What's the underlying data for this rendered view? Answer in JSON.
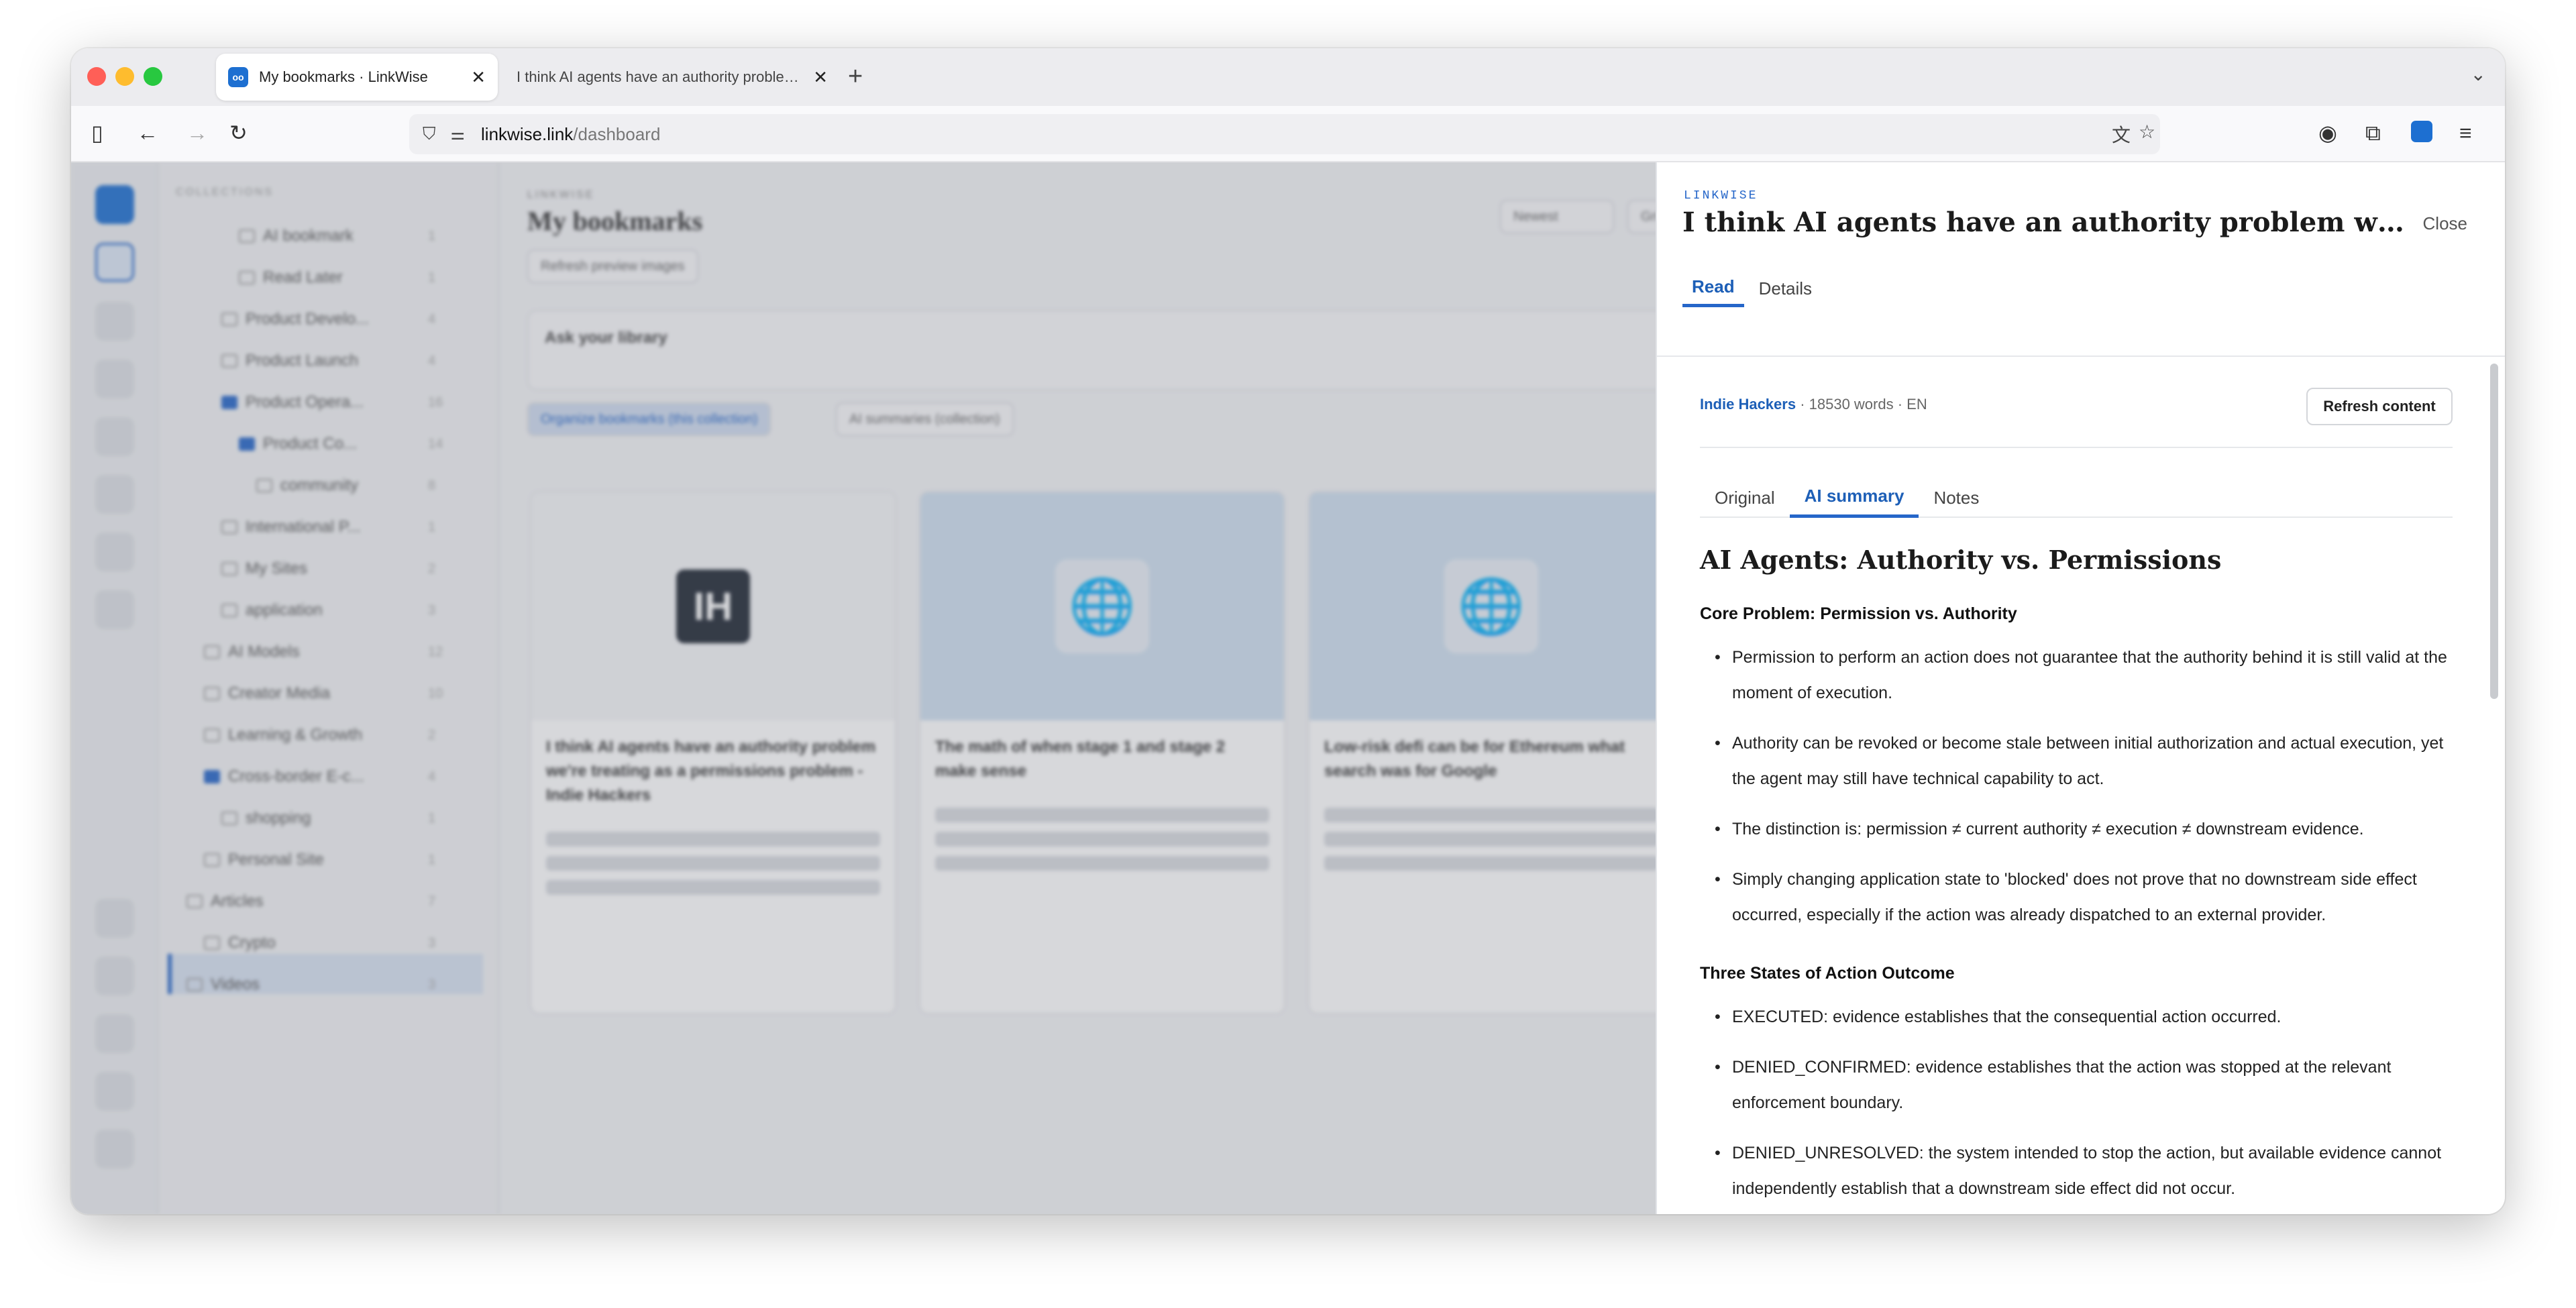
{
  "browser": {
    "tabs": [
      {
        "title": "My bookmarks · LinkWise",
        "close": "✕",
        "active": true
      },
      {
        "title": "I think AI agents have an authority problem we're treating as a permissions problem",
        "close": "✕",
        "active": false
      }
    ],
    "new_tab": "+",
    "tabs_menu": "⌄",
    "url_host": "linkwise.link",
    "url_path": "/dashboard",
    "favicon_text": "oo"
  },
  "app": {
    "sidebar_header": "COLLECTIONS",
    "tree": [
      {
        "label": "AI bookmark",
        "count": "1",
        "indent": 3
      },
      {
        "label": "Read Later",
        "count": "1",
        "indent": 3
      },
      {
        "label": "Product Develo...",
        "count": "4",
        "indent": 2
      },
      {
        "label": "Product Launch",
        "count": "4",
        "indent": 2
      },
      {
        "label": "Product Opera...",
        "count": "16",
        "indent": 2,
        "blue": true
      },
      {
        "label": "Product Co...",
        "count": "14",
        "indent": 3,
        "blue": true
      },
      {
        "label": "community",
        "count": "8",
        "indent": 4
      },
      {
        "label": "International P...",
        "count": "1",
        "indent": 2
      },
      {
        "label": "My Sites",
        "count": "2",
        "indent": 2
      },
      {
        "label": "application",
        "count": "3",
        "indent": 2
      },
      {
        "label": "AI Models",
        "count": "12",
        "indent": 1
      },
      {
        "label": "Creator Media",
        "count": "10",
        "indent": 1
      },
      {
        "label": "Learning & Growth",
        "count": "2",
        "indent": 1
      },
      {
        "label": "Cross-border E-c...",
        "count": "4",
        "indent": 1,
        "blue": true
      },
      {
        "label": "shopping",
        "count": "1",
        "indent": 2
      },
      {
        "label": "Personal Site",
        "count": "1",
        "indent": 1
      },
      {
        "label": "Articles",
        "count": "7",
        "indent": 0
      },
      {
        "label": "Crypto",
        "count": "3",
        "indent": 1
      },
      {
        "label": "Videos",
        "count": "3",
        "indent": 0
      }
    ],
    "brand": "LINKWISE",
    "title": "My bookmarks",
    "sort": "Newest",
    "view": "Grid",
    "refresh_previews": "Refresh preview images",
    "ask_title": "Ask your library",
    "organize": "Organize bookmarks (this collection)",
    "ai_summaries": "AI summaries (collection)",
    "cards": [
      {
        "title": "I think AI agents have an authority problem we're treating as a permissions problem - Indie Hackers",
        "logo": "IH"
      },
      {
        "title": "The math of when stage 1 and stage 2 make sense",
        "logo": "🌐"
      },
      {
        "title": "Low-risk defi can be for Ethereum what search was for Google",
        "logo": "🌐"
      }
    ]
  },
  "panel": {
    "brand": "LINKWISE",
    "title": "I think AI agents have an authority problem we're treat...",
    "close": "Close",
    "tabs": [
      "Read",
      "Details"
    ],
    "source": "Indie Hackers",
    "meta_rest": " · 18530 words · EN",
    "refresh": "Refresh content",
    "sub_tabs": [
      "Original",
      "AI summary",
      "Notes"
    ],
    "summary": {
      "heading": "AI Agents: Authority vs. Permissions",
      "sections": [
        {
          "title": "Core Problem: Permission vs. Authority",
          "bullets": [
            "Permission to perform an action does not guarantee that the authority behind it is still valid at the moment of execution.",
            "Authority can be revoked or become stale between initial authorization and actual execution, yet the agent may still have technical capability to act.",
            "The distinction is: permission ≠ current authority ≠ execution ≠ downstream evidence.",
            "Simply changing application state to 'blocked' does not prove that no downstream side effect occurred, especially if the action was already dispatched to an external provider."
          ]
        },
        {
          "title": "Three States of Action Outcome",
          "bullets": [
            "EXECUTED: evidence establishes that the consequential action occurred.",
            "DENIED_CONFIRMED: evidence establishes that the action was stopped at the relevant enforcement boundary.",
            "DENIED_UNRESOLVED: the system intended to stop the action, but available evidence cannot independently establish that a downstream side effect did not occur."
          ]
        }
      ]
    }
  }
}
